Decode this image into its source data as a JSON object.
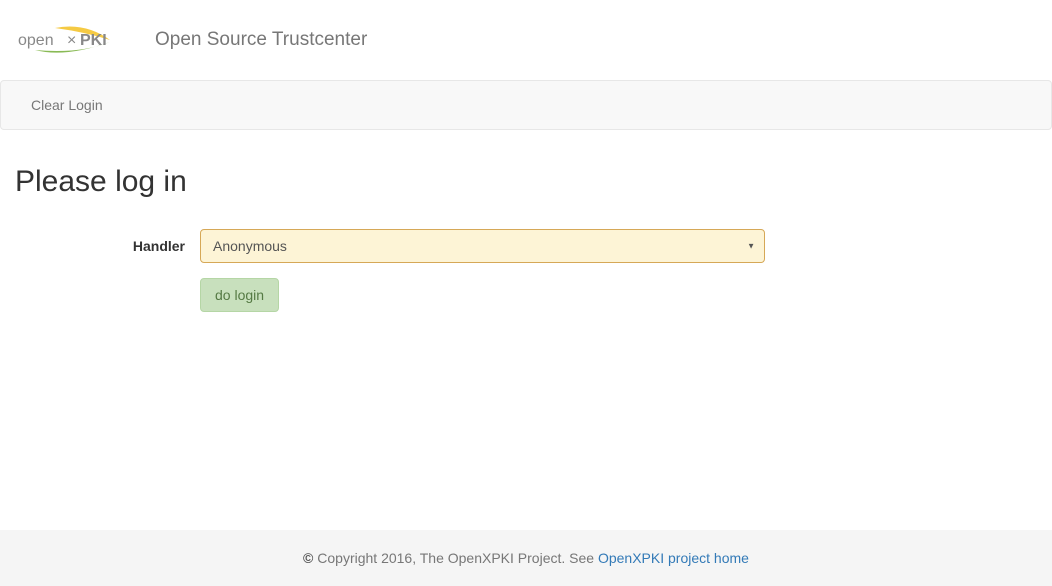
{
  "header": {
    "app_title": "Open Source Trustcenter"
  },
  "navbar": {
    "clear_login": "Clear Login"
  },
  "main": {
    "page_title": "Please log in",
    "form": {
      "handler_label": "Handler",
      "handler_value": "Anonymous",
      "submit_label": "do login"
    }
  },
  "footer": {
    "copyright_symbol": "©",
    "copyright_text": " Copyright 2016, The OpenXPKI Project. See ",
    "link_text": "OpenXPKI project home"
  }
}
